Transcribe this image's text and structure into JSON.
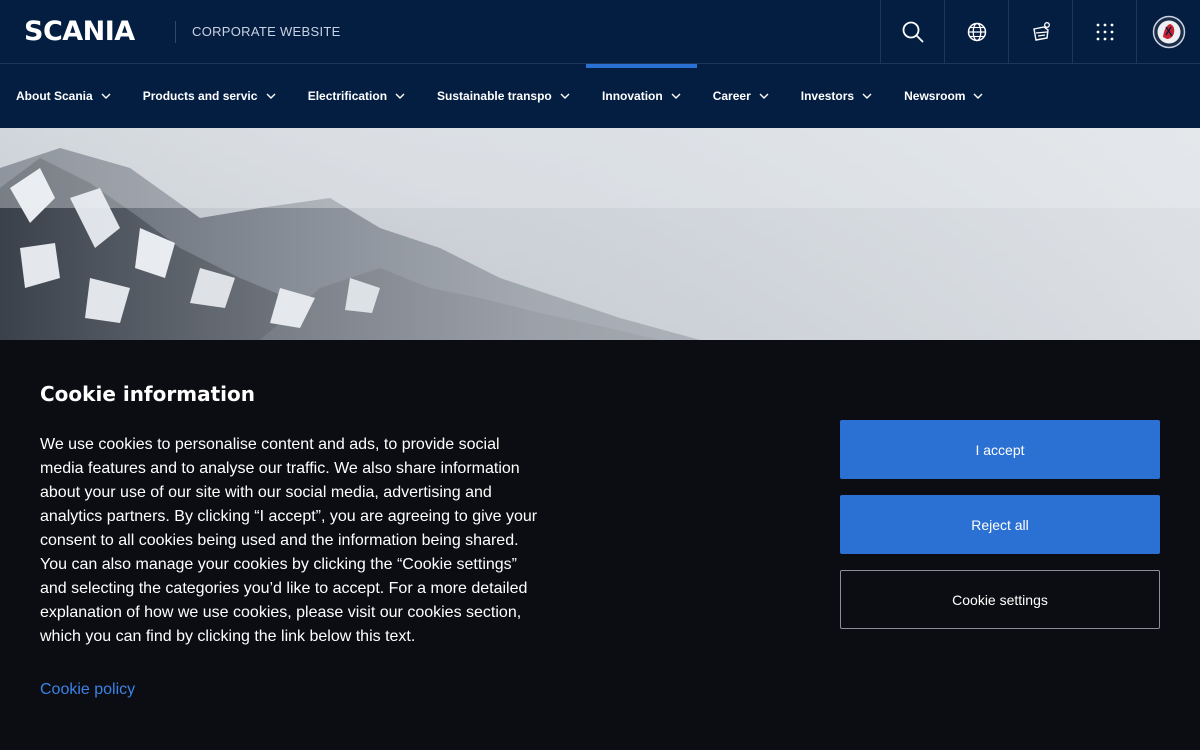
{
  "header": {
    "logo_text": "SCANIA",
    "site_label": "CORPORATE WEBSITE",
    "icons": [
      "search-icon",
      "globe-icon",
      "truck-configurator-icon",
      "apps-grid-icon",
      "scania-griffin-icon"
    ]
  },
  "nav": {
    "items": [
      {
        "label": "About Scania"
      },
      {
        "label": "Products and services"
      },
      {
        "label": "Electrification"
      },
      {
        "label": "Sustainable transport"
      },
      {
        "label": "Innovation"
      },
      {
        "label": "Career"
      },
      {
        "label": "Investors"
      },
      {
        "label": "Newsroom"
      }
    ],
    "active": "Innovation"
  },
  "cookie": {
    "title": "Cookie information",
    "body": "We use cookies to personalise content and ads, to provide social media features and to analyse our traffic. We also share information about your use of our site with our social media, advertising and analytics partners. By clicking “I accept”, you are agreeing to give your consent to all cookies being used and the information being shared. You can also manage your cookies by clicking the “Cookie settings” and selecting the categories you’d like to accept. For a more detailed explanation of how we use cookies, please visit our cookies section, which you can find by clicking the link below this text.",
    "link": "Cookie policy",
    "accept_label": "I accept",
    "reject_label": "Reject all",
    "settings_label": "Cookie settings"
  },
  "colors": {
    "header_bg": "#041e42",
    "accent": "#2b70d3",
    "panel_bg": "#0b0d12",
    "link": "#3b82e6"
  }
}
